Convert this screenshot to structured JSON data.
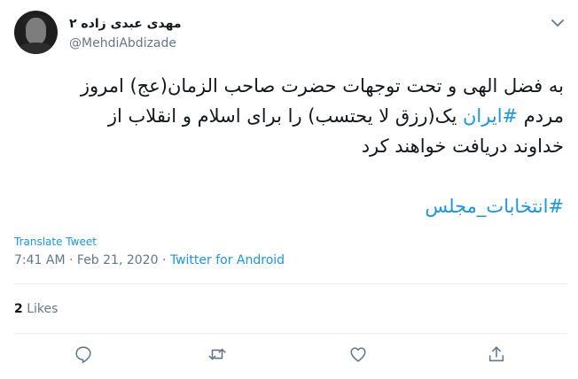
{
  "user": {
    "display_name": "مهدی عبدی زاده ۲",
    "username": "@MehdiAbdizade",
    "avatar_icon": "avatar-photo"
  },
  "tweet": {
    "line1": "به فضل الهی و تحت توجهات حضرت صاحب الزمان(عج) امروز",
    "line2_before": "مردم ",
    "hashtag_iran": "#ایران",
    "line2_after": " یک(رزق لا یحتسب) را برای اسلام و انقلاب از",
    "line3": "خداوند دریافت خواهند کرد",
    "hashtag_elections": "#انتخابات_مجلس"
  },
  "translate_label": "Translate Tweet",
  "meta": {
    "time": "7:41 AM",
    "separator": " · ",
    "date": "Feb 21, 2020",
    "separator2": " · ",
    "source": "Twitter for Android"
  },
  "engagement": {
    "likes_count": "2",
    "likes_label": " Likes"
  },
  "icons": {
    "menu": "chevron-down-icon",
    "reply": "reply-icon",
    "retweet": "retweet-icon",
    "like": "heart-icon",
    "share": "share-icon"
  },
  "colors": {
    "link": "#1b95e0",
    "secondary_text": "#657786",
    "divider": "#e6ecf0"
  }
}
